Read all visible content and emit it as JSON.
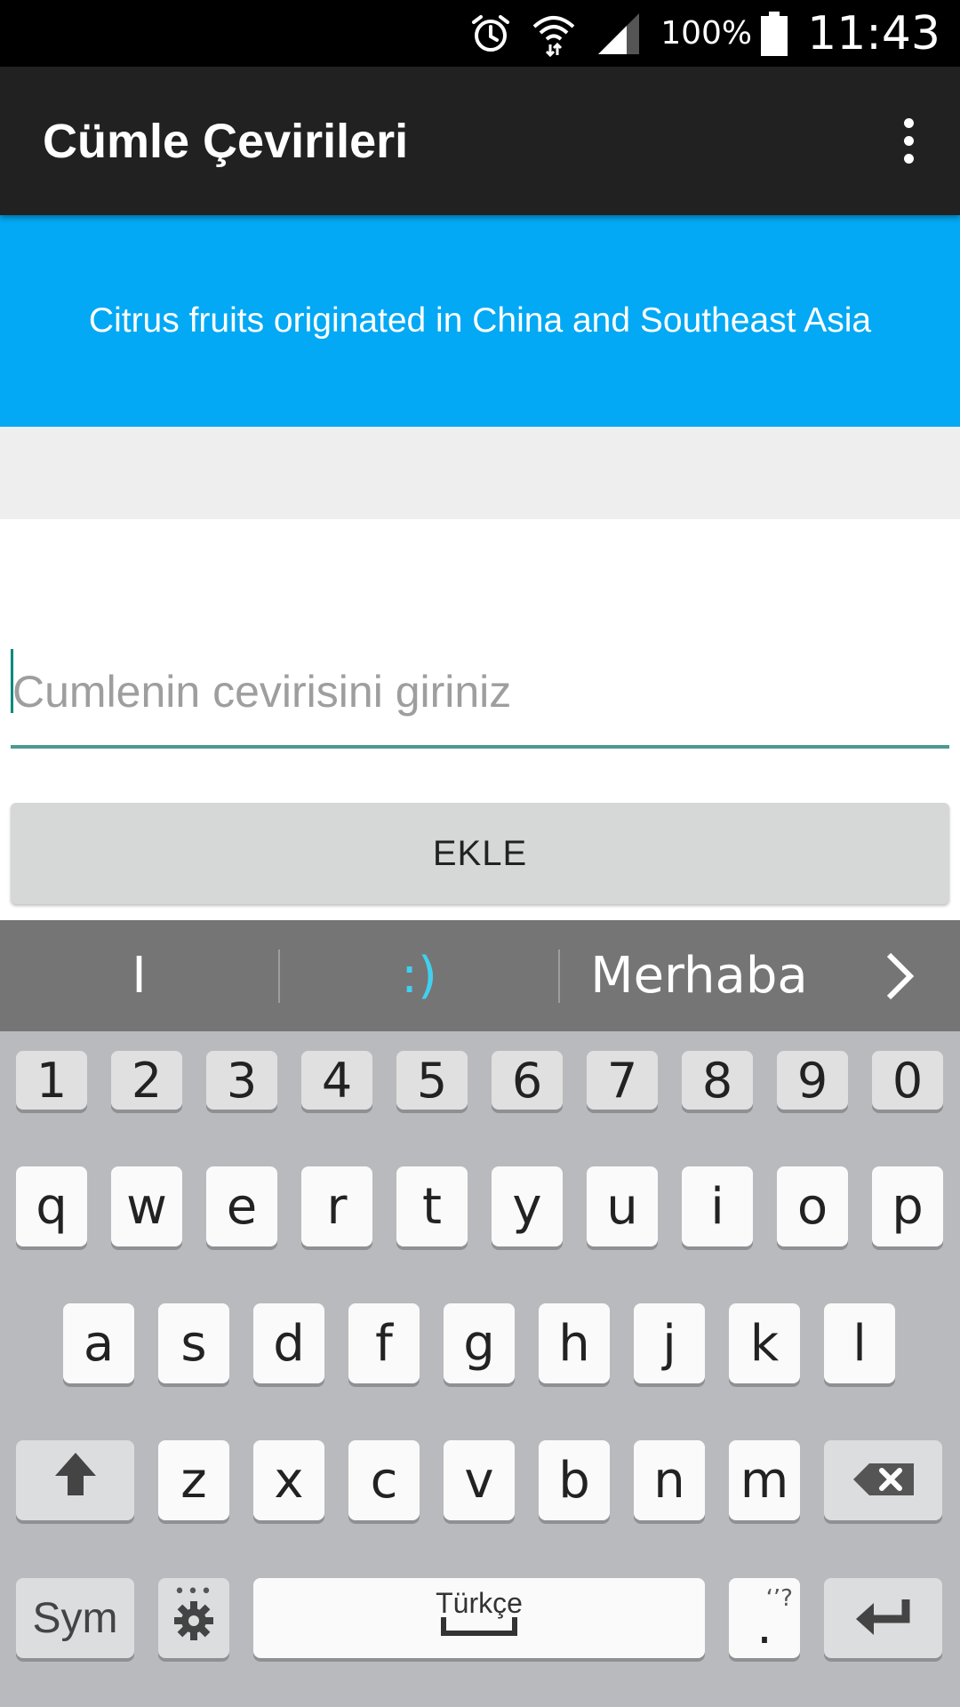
{
  "status_bar": {
    "battery_percent": "100%",
    "time": "11:43",
    "icons": [
      "alarm-icon",
      "wifi-icon",
      "signal-icon",
      "battery-icon"
    ]
  },
  "app_bar": {
    "title": "Cümle Çevirileri",
    "overflow_icon": "more-vert-icon"
  },
  "sentence_card": {
    "text": "Citrus fruits originated in China and Southeast Asia",
    "color": "#03a9f4"
  },
  "translation_input": {
    "placeholder": "Cumlenin cevirisini giriniz",
    "value": ""
  },
  "add_button": {
    "label": "EKLE"
  },
  "keyboard": {
    "suggestions": [
      "I",
      ":)",
      "Merhaba"
    ],
    "number_row": [
      "1",
      "2",
      "3",
      "4",
      "5",
      "6",
      "7",
      "8",
      "9",
      "0"
    ],
    "row1": [
      "q",
      "w",
      "e",
      "r",
      "t",
      "y",
      "u",
      "i",
      "o",
      "p"
    ],
    "row2": [
      "a",
      "s",
      "d",
      "f",
      "g",
      "h",
      "j",
      "k",
      "l"
    ],
    "row3": [
      "z",
      "x",
      "c",
      "v",
      "b",
      "n",
      "m"
    ],
    "sym_label": "Sym",
    "space_label": "Türkçe",
    "period_key": ".",
    "period_alt": "‘’?"
  }
}
